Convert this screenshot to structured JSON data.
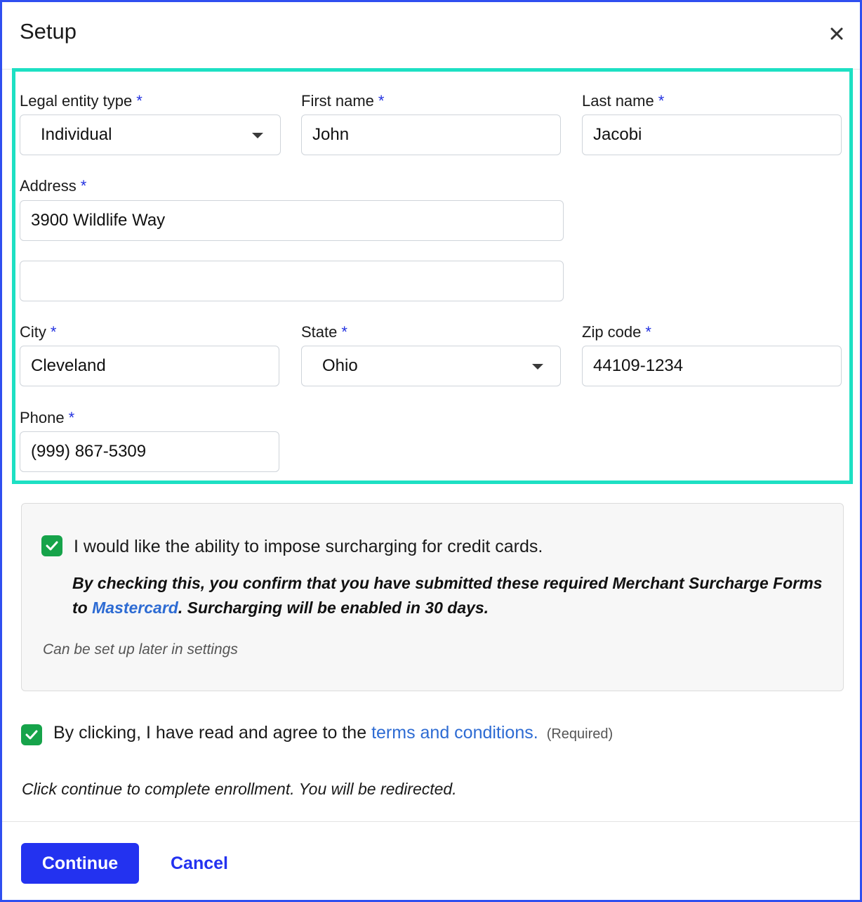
{
  "dialog": {
    "title": "Setup",
    "close_icon": "close-icon"
  },
  "form": {
    "legal_entity_type": {
      "label": "Legal entity type",
      "required_mark": "*",
      "value": "Individual"
    },
    "first_name": {
      "label": "First name",
      "required_mark": "*",
      "value": "John"
    },
    "last_name": {
      "label": "Last name",
      "required_mark": "*",
      "value": "Jacobi"
    },
    "address": {
      "label": "Address",
      "required_mark": "*",
      "line1": "3900 Wildlife Way",
      "line2": ""
    },
    "city": {
      "label": "City",
      "required_mark": "*",
      "value": "Cleveland"
    },
    "state": {
      "label": "State",
      "required_mark": "*",
      "value": "Ohio"
    },
    "zip": {
      "label": "Zip code",
      "required_mark": "*",
      "value": "44109-1234"
    },
    "phone": {
      "label": "Phone",
      "required_mark": "*",
      "value": "(999) 867-5309"
    }
  },
  "surcharge": {
    "checked": true,
    "label": "I would like the ability to impose surcharging for credit cards.",
    "confirm_prefix": "By checking this, you confirm that you have submitted these required Merchant Surcharge Forms to ",
    "confirm_link": "Mastercard",
    "confirm_suffix": ". Surcharging will be enabled in 30 days.",
    "note": "Can be set up later in settings"
  },
  "terms": {
    "checked": true,
    "prefix": "By clicking, I have read and agree to the ",
    "link": "terms and conditions.",
    "required": "(Required)"
  },
  "redirect_note": "Click continue to complete enrollment. You will be redirected.",
  "actions": {
    "continue_label": "Continue",
    "cancel_label": "Cancel"
  },
  "colors": {
    "accent": "#2332f0",
    "highlight": "#1de0c3",
    "check": "#16a34a",
    "link": "#2d6bd3"
  }
}
